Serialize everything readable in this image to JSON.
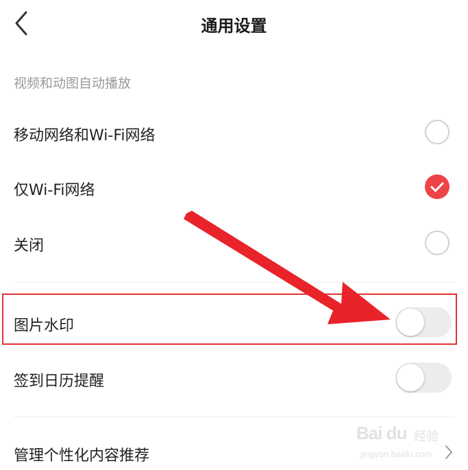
{
  "header": {
    "title": "通用设置",
    "back_icon": "chevron-left-icon"
  },
  "autoplay_section": {
    "title": "视频和动图自动播放",
    "options": [
      {
        "label": "移动网络和Wi-Fi网络",
        "selected": false
      },
      {
        "label": "仅Wi-Fi网络",
        "selected": true
      },
      {
        "label": "关闭",
        "selected": false
      }
    ]
  },
  "toggles": [
    {
      "label": "图片水印",
      "on": false
    },
    {
      "label": "签到日历提醒",
      "on": false
    }
  ],
  "links": [
    {
      "label": "管理个性化内容推荐",
      "icon": "chevron-right-icon"
    }
  ],
  "colors": {
    "accent": "#ee4447",
    "annotation": "#e53030"
  },
  "watermark": {
    "brand": "Bai du",
    "sub": "经验",
    "url": "jingyan.baidu.com"
  }
}
